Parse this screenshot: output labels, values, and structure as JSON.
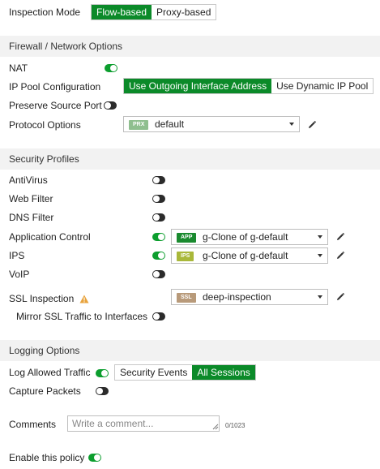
{
  "inspection_mode": {
    "label": "Inspection Mode",
    "options": [
      "Flow-based",
      "Proxy-based"
    ],
    "selected": "Flow-based"
  },
  "firewall_section": {
    "title": "Firewall / Network Options",
    "nat_label": "NAT",
    "nat_enabled": true,
    "ip_pool_label": "IP Pool Configuration",
    "ip_pool_options": [
      "Use Outgoing Interface Address",
      "Use Dynamic IP Pool"
    ],
    "ip_pool_selected": "Use Outgoing Interface Address",
    "preserve_label": "Preserve Source Port",
    "preserve_enabled": false,
    "protocol_label": "Protocol Options",
    "protocol_tag": "PRX",
    "protocol_value": "default",
    "protocol_tag_color": "#8fbf8f"
  },
  "security_section": {
    "title": "Security Profiles",
    "antivirus_label": "AntiVirus",
    "webfilter_label": "Web Filter",
    "dnsfilter_label": "DNS Filter",
    "appcontrol_label": "Application Control",
    "appcontrol_tag": "APP",
    "appcontrol_value": "g-Clone of g-default",
    "appcontrol_tag_color": "#1a8a2f",
    "ips_label": "IPS",
    "ips_tag": "IPS",
    "ips_value": "g-Clone of g-default",
    "ips_tag_color": "#a9b83a",
    "voip_label": "VoIP",
    "ssl_label": "SSL Inspection",
    "ssl_tag": "SSL",
    "ssl_value": "deep-inspection",
    "ssl_tag_color": "#b89a7a",
    "mirror_label": "Mirror SSL Traffic to Interfaces"
  },
  "logging_section": {
    "title": "Logging Options",
    "log_label": "Log Allowed Traffic",
    "log_options": [
      "Security Events",
      "All Sessions"
    ],
    "log_selected": "All Sessions",
    "capture_label": "Capture Packets"
  },
  "comments": {
    "label": "Comments",
    "placeholder": "Write a comment...",
    "counter": "0/1023"
  },
  "enable_policy_label": "Enable this policy",
  "icons": {
    "edit": "pencil-icon",
    "warning": "warning-icon",
    "caret": "chevron-down-icon"
  },
  "colors": {
    "accent_green": "#0b8a29",
    "toggle_on": "#0c9e2e",
    "toggle_off": "#2b2b2b",
    "warning": "#e8a33d",
    "section_bg": "#f2f2f2"
  }
}
